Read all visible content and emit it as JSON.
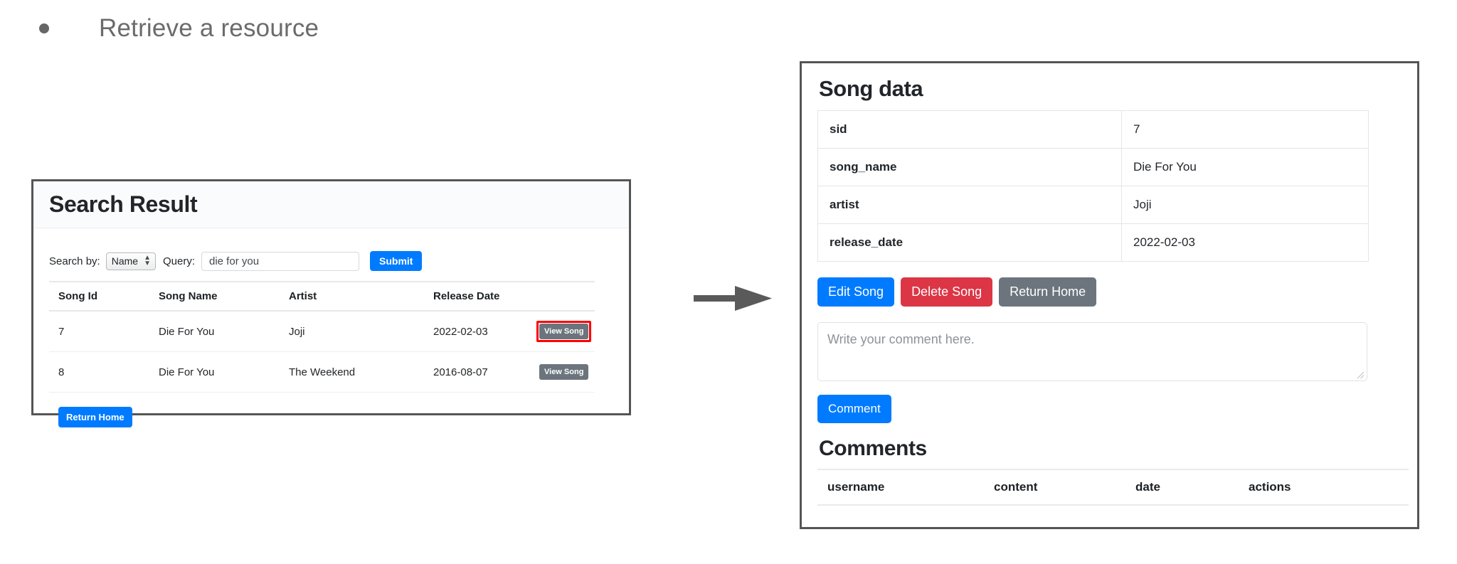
{
  "slide": {
    "bullet_text": "Retrieve a resource",
    "bullet_icon": "bullet-dot"
  },
  "flow": {
    "arrow_icon": "right-arrow-icon"
  },
  "colors": {
    "primary": "#007bff",
    "danger": "#dc3545",
    "secondary": "#6c757d",
    "highlight": "#ff0000",
    "panel_border": "#555555"
  },
  "search_panel": {
    "title": "Search Result",
    "search_by_label": "Search by:",
    "search_by_value": "Name",
    "query_label": "Query:",
    "query_value": "die for you",
    "query_placeholder": "die for you",
    "submit_label": "Submit",
    "return_home_label": "Return Home",
    "table": {
      "columns": [
        "Song Id",
        "Song Name",
        "Artist",
        "Release Date",
        ""
      ],
      "rows": [
        {
          "song_id": "7",
          "song_name": "Die For You",
          "artist": "Joji",
          "release_date": "2022-02-03",
          "action_label": "View Song",
          "highlighted": true
        },
        {
          "song_id": "8",
          "song_name": "Die For You",
          "artist": "The Weekend",
          "release_date": "2016-08-07",
          "action_label": "View Song",
          "highlighted": false
        }
      ]
    }
  },
  "detail_panel": {
    "title": "Song data",
    "fields": [
      {
        "key": "sid",
        "value": "7"
      },
      {
        "key": "song_name",
        "value": "Die For You"
      },
      {
        "key": "artist",
        "value": "Joji"
      },
      {
        "key": "release_date",
        "value": "2022-02-03"
      }
    ],
    "actions": {
      "edit_label": "Edit Song",
      "delete_label": "Delete Song",
      "return_home_label": "Return Home"
    },
    "comment_box": {
      "placeholder": "Write your comment here.",
      "value": "",
      "submit_label": "Comment"
    },
    "comments": {
      "heading": "Comments",
      "columns": [
        "username",
        "content",
        "date",
        "actions"
      ],
      "rows": []
    }
  }
}
